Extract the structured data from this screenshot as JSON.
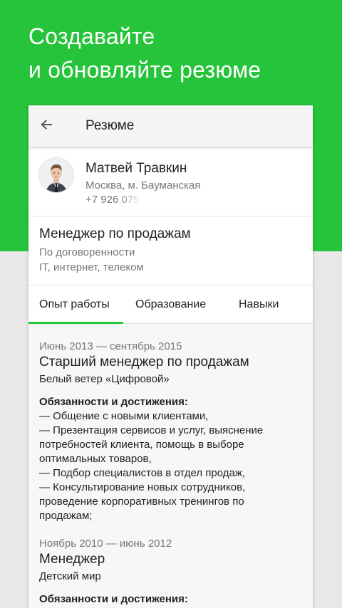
{
  "promo": {
    "line1": "Создавайте",
    "line2": "и обновляйте резюме"
  },
  "toolbar": {
    "title": "Резюме",
    "back_icon": "arrow-back-icon"
  },
  "profile": {
    "name": "Матвей Травкин",
    "location": "Москва, м. Бауманская",
    "phone": "+7 926 075"
  },
  "position": {
    "title": "Менеджер по продажам",
    "salary": "По договоренности",
    "industry": "IT, интернет, телеком"
  },
  "tabs": [
    {
      "label": "Опыт работы",
      "active": true
    },
    {
      "label": "Образование",
      "active": false
    },
    {
      "label": "Навыки",
      "active": false
    }
  ],
  "jobs": [
    {
      "period": "Июнь 2013 — сентябрь 2015",
      "title": "Старший менеджер по продажам",
      "company": "Белый ветер «Цифровой»",
      "duties_title": "Обязанности и достижения:",
      "duties": [
        "— Общение с новыми клиентами,",
        "— Презентация сервисов и услуг, выяснение",
        "потребностей клиента, помощь в выборе",
        "оптимальных товаров,",
        "— Подбор специалистов в отдел продаж,",
        "— Консультирование новых сотрудников,",
        "проведение корпоративных тренингов по",
        "продажам;"
      ]
    },
    {
      "period": "Ноябрь 2010 — июнь 2012",
      "title": "Менеджер",
      "company": "Детский мир",
      "duties_title": "Обязанности и достижения:",
      "duties": []
    }
  ],
  "colors": {
    "brand_green": "#26c43a",
    "background": "#e8e8e8",
    "text_primary": "#222222",
    "text_secondary": "#777777"
  }
}
